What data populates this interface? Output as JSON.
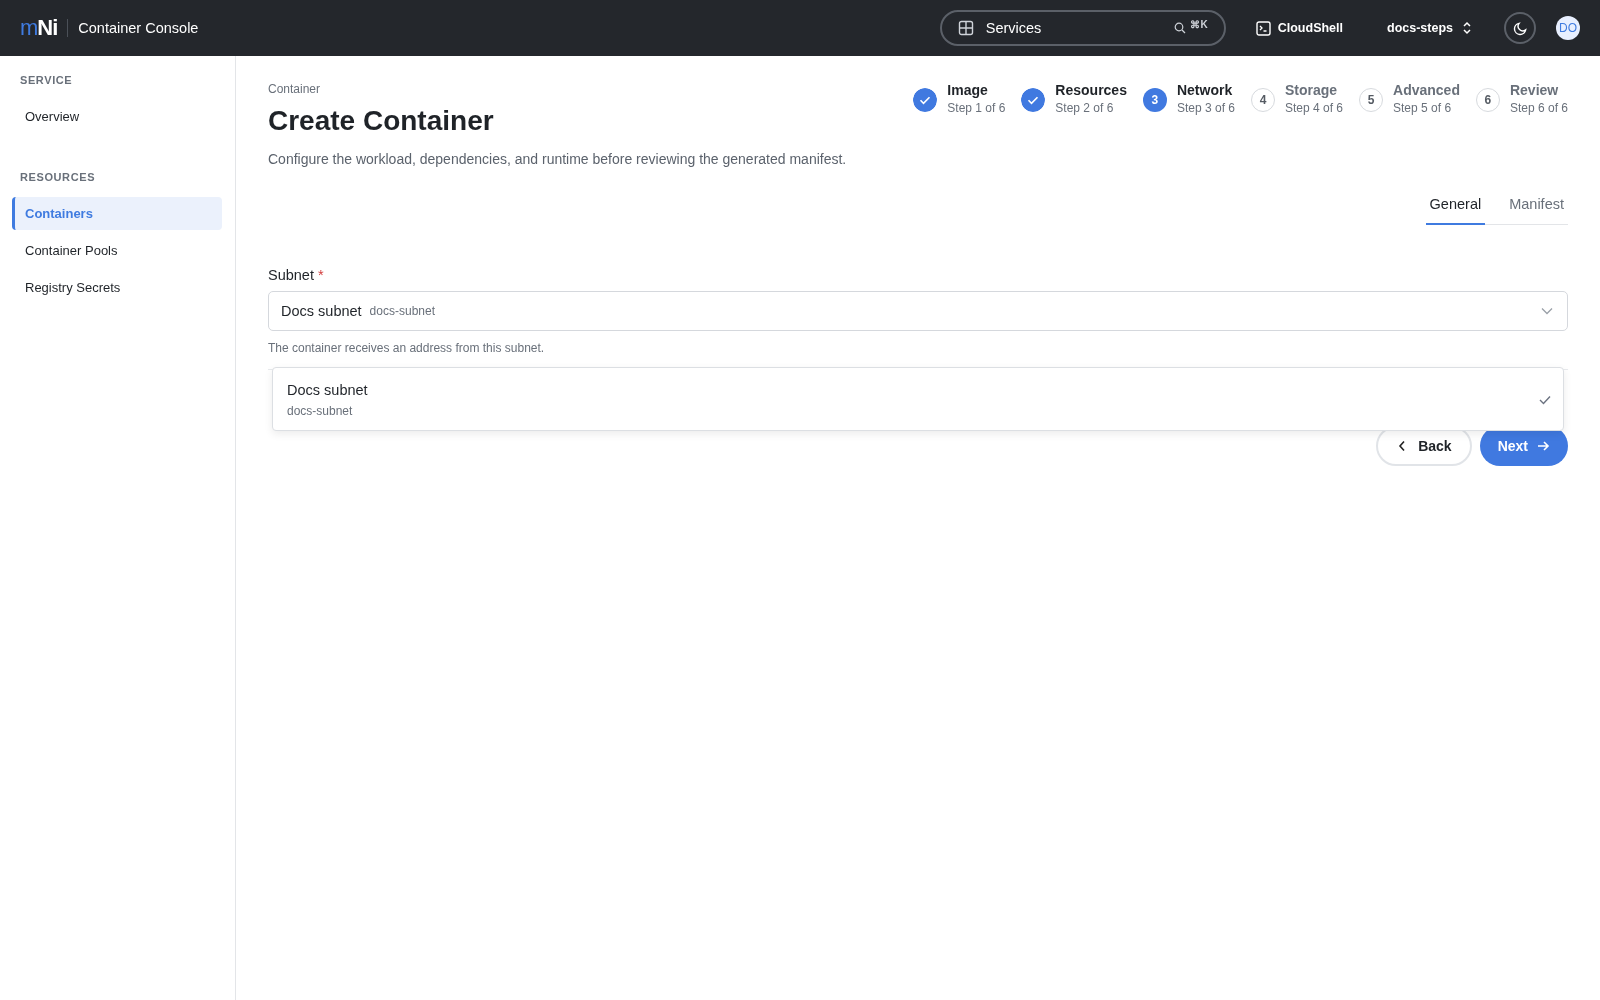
{
  "header": {
    "logo": {
      "first": "m",
      "second": "Ni"
    },
    "app_title": "Container Console",
    "search": {
      "value": "Services",
      "shortcut": "⌘K"
    },
    "cloudshell": "CloudShell",
    "project": "docs-steps",
    "avatar": "DO"
  },
  "sidebar": {
    "sections": [
      {
        "heading": "SERVICE",
        "items": [
          {
            "label": "Overview",
            "selected": false
          }
        ]
      },
      {
        "heading": "RESOURCES",
        "items": [
          {
            "label": "Containers",
            "selected": true
          },
          {
            "label": "Container Pools",
            "selected": false
          },
          {
            "label": "Registry Secrets",
            "selected": false
          }
        ]
      }
    ]
  },
  "breadcrumb": "Container",
  "title": "Create Container",
  "description": "Configure the workload, dependencies, and runtime before reviewing the generated manifest.",
  "steps": [
    {
      "done": true,
      "name": "Image",
      "caption": "Step 1 of 6"
    },
    {
      "done": true,
      "name": "Resources",
      "caption": "Step 2 of 6"
    },
    {
      "done": false,
      "current": true,
      "number": "3",
      "name": "Network",
      "caption": "Step 3 of 6"
    },
    {
      "done": false,
      "current": false,
      "number": "4",
      "name": "Storage",
      "caption": "Step 4 of 6"
    },
    {
      "done": false,
      "current": false,
      "number": "5",
      "name": "Advanced",
      "caption": "Step 5 of 6"
    },
    {
      "done": false,
      "current": false,
      "number": "6",
      "name": "Review",
      "caption": "Step 6 of 6"
    }
  ],
  "tabs": [
    {
      "label": "General",
      "selected": true
    },
    {
      "label": "Manifest",
      "selected": false
    }
  ],
  "field": {
    "label": "Subnet",
    "required": true,
    "required_mark": "*",
    "value": "Docs subnet",
    "value_id": "docs-subnet",
    "helper": "The container receives an address from this subnet.",
    "expanded": true,
    "options": [
      {
        "label": "Docs subnet",
        "sublabel": "docs-subnet",
        "selected": true
      }
    ]
  },
  "buttons": {
    "back": "Back",
    "next": "Next"
  }
}
